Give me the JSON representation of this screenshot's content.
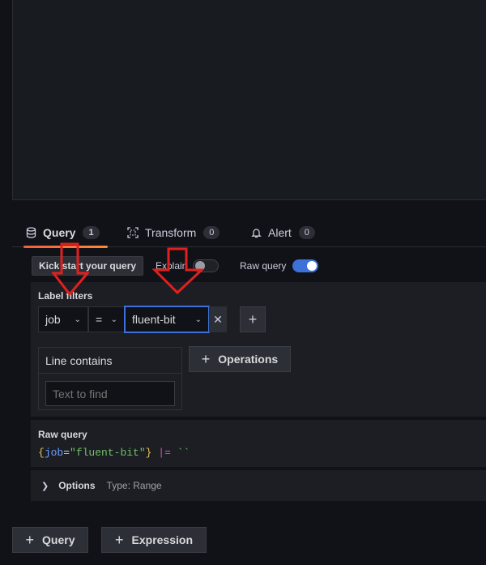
{
  "tabs": [
    {
      "label": "Query",
      "count": "1",
      "icon": "database-icon"
    },
    {
      "label": "Transform",
      "count": "0",
      "icon": "transform-icon"
    },
    {
      "label": "Alert",
      "count": "0",
      "icon": "bell-icon"
    }
  ],
  "toolbar": {
    "kickstart_label": "Kick start your query",
    "explain_label": "Explain",
    "explain_on": false,
    "raw_query_label": "Raw query",
    "raw_query_on": true
  },
  "label_filters": {
    "title": "Label filters",
    "label": "job",
    "operator": "=",
    "value": "fluent-bit"
  },
  "line_contains": {
    "title": "Line contains",
    "placeholder": "Text to find"
  },
  "operations_label": "Operations",
  "raw_query": {
    "title": "Raw query",
    "open_brace": "{",
    "key": "job",
    "eq": "=",
    "value": "\"fluent-bit\"",
    "close_brace": "}",
    "pipe_op": "|=",
    "pipe_value": "``"
  },
  "options": {
    "label": "Options",
    "type": "Type: Range"
  },
  "bottom_buttons": {
    "query_label": "Query",
    "expression_label": "Expression"
  },
  "colors": {
    "accent_blue": "#3d71d9",
    "active_tab_underline": "#f55f3e",
    "annotation_arrow": "#e02020"
  }
}
